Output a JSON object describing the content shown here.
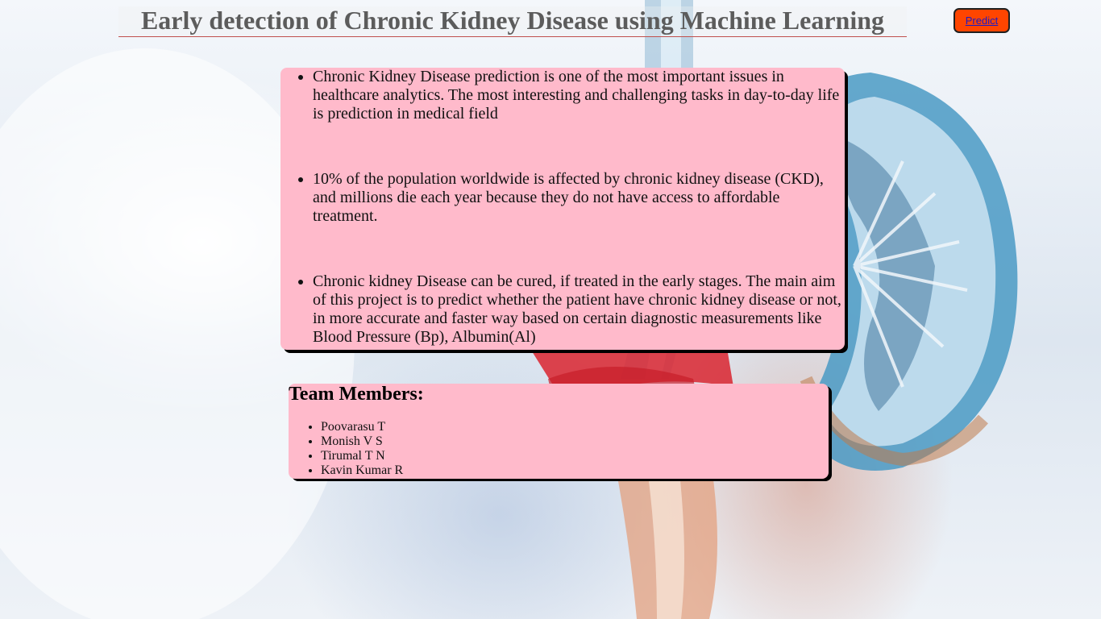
{
  "header": {
    "title": "Early detection of Chronic Kidney Disease using Machine Learning"
  },
  "nav": {
    "predict_label": "Predict"
  },
  "info": {
    "items": [
      "Chronic Kidney Disease prediction is one of the most important issues in healthcare analytics. The most interesting and challenging tasks in day-to-day life is prediction in medical field",
      "10% of the population worldwide is affected by chronic kidney disease (CKD), and millions die each year because they do not have access to affordable treatment.",
      "Chronic kidney Disease can be cured, if treated in the early stages. The main aim of this project is to predict whether the patient have chronic kidney disease or not, in more accurate and faster way based on certain diagnostic measurements like Blood Pressure (Bp), Albumin(Al)"
    ]
  },
  "team": {
    "heading": "Team Members:",
    "members": [
      "Poovarasu T",
      "Monish V S",
      "Tirumal T N",
      "Kavin Kumar R"
    ]
  },
  "colors": {
    "card_background": "#ffbacb",
    "button_background": "#ff4500",
    "header_rule": "#c0504d",
    "title_text": "#5c5c5c"
  }
}
